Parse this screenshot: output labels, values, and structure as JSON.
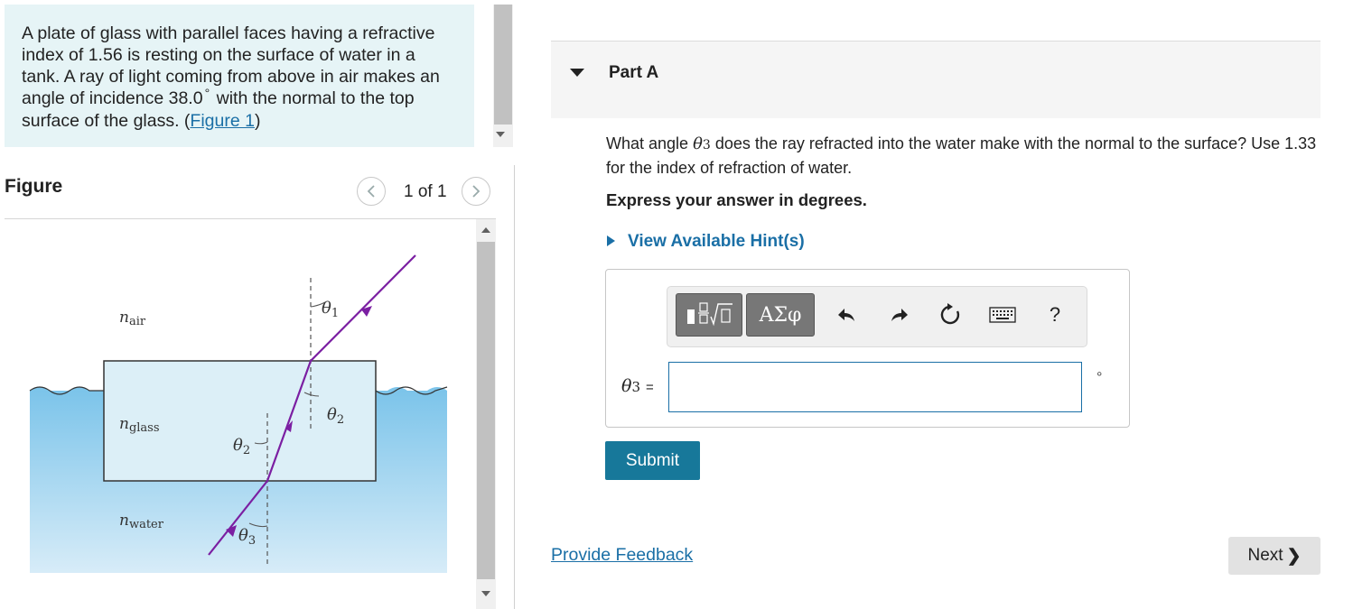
{
  "problem": {
    "text_before_angle": "A plate of glass with parallel faces having a refractive index of 1.56 is resting on the surface of water in a tank. A ray of light coming from above in air makes an angle of incidence 38.0",
    "degree_symbol": "°",
    "text_after_angle": " with the normal to the top surface of the glass. (",
    "figure_link": "Figure 1",
    "closing": ")"
  },
  "figure_panel": {
    "label": "Figure",
    "counter": "1 of 1",
    "prev_icon": "chevron-left-icon",
    "next_icon": "chevron-right-icon",
    "labels": {
      "n_air": "n",
      "n_air_sub": "air",
      "n_glass": "n",
      "n_glass_sub": "glass",
      "n_water": "n",
      "n_water_sub": "water",
      "theta1": "θ",
      "theta1_sub": "1",
      "theta2": "θ",
      "theta2_sub": "2",
      "theta3": "θ",
      "theta3_sub": "3"
    },
    "colors": {
      "water_top": "#7cc4ea",
      "water_bottom": "#d7ecf8",
      "glass": "#dceff7",
      "ray": "#7b1fa2"
    }
  },
  "part": {
    "title": "Part A",
    "question_prefix": "What angle ",
    "question_theta": "θ",
    "question_theta_sub": "3",
    "question_suffix": " does the ray refracted into the water make with the normal to the surface? Use 1.33 for the index of refraction of water.",
    "instruction": "Express your answer in degrees.",
    "hint_link": "View Available Hint(s)"
  },
  "toolbar": {
    "greek_label": "ΑΣφ",
    "help_label": "?",
    "icons": [
      "templates-icon",
      "greek-icon",
      "undo-icon",
      "redo-icon",
      "reset-icon",
      "keyboard-icon",
      "help-icon"
    ]
  },
  "answer": {
    "var": "θ",
    "var_sub": "3",
    "equals": "=",
    "value": "",
    "unit": "°"
  },
  "buttons": {
    "submit": "Submit",
    "feedback": "Provide Feedback",
    "next": "Next",
    "next_chevron": "❯"
  },
  "colors": {
    "accent": "#1a6fa6",
    "submit_bg": "#17789a",
    "problem_bg": "#e6f4f6"
  }
}
